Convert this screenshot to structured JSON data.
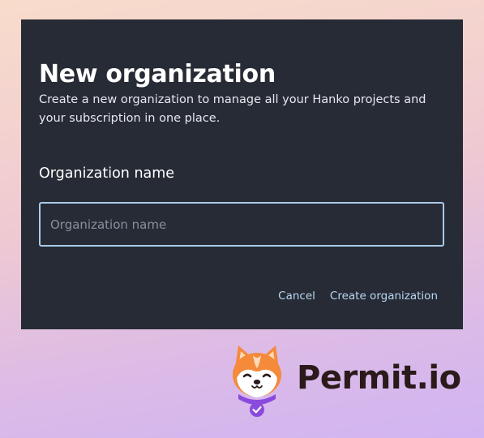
{
  "dialog": {
    "title": "New organization",
    "description": "Create a new organization to manage all your Hanko projects and your subscription in one place.",
    "field_label": "Organization name",
    "input": {
      "value": "",
      "placeholder": "Organization name"
    },
    "cancel_label": "Cancel",
    "create_label": "Create organization"
  },
  "branding": {
    "wordmark": "Permit.io",
    "logo_icon": "shiba-dog-icon"
  },
  "colors": {
    "dialog_bg": "#272b35",
    "accent": "#b9d7f1",
    "input_border": "#a9cbe8",
    "logo_orange": "#f48a3a",
    "logo_purple": "#8a4bdc"
  }
}
